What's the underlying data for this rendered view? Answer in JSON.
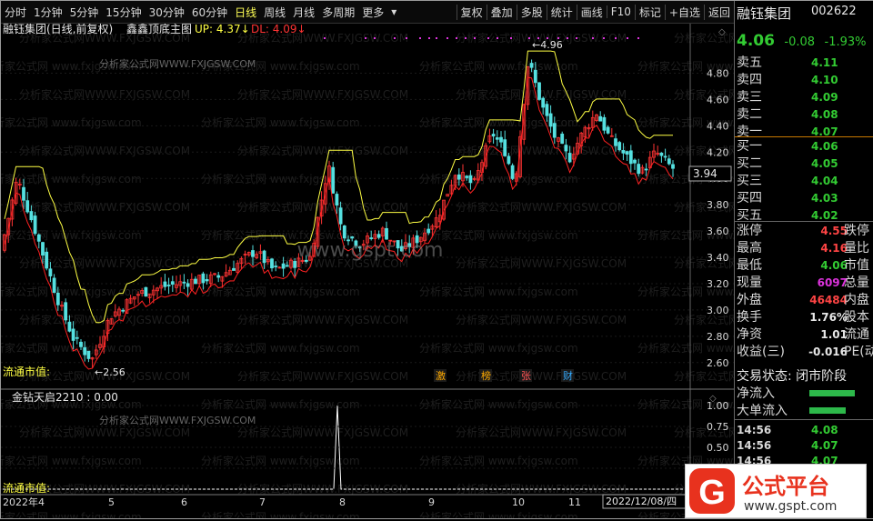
{
  "toolbar": {
    "left": [
      "分时",
      "1分钟",
      "5分钟",
      "15分钟",
      "30分钟",
      "60分钟",
      "日线",
      "周线",
      "月线",
      "多周期",
      "更多"
    ],
    "more_arrow": "▾",
    "right": [
      "复权",
      "叠加",
      "多股",
      "统计",
      "画线",
      "F10",
      "标记",
      "+自选",
      "返回"
    ],
    "active": "日线"
  },
  "chart": {
    "title": "融钰集团(日线,前复权)",
    "indicator": "鑫鑫顶底主图",
    "up": "UP: 4.37↓",
    "dl": "DL: 4.09↓",
    "high_mark": "4.96",
    "low_mark": "2.56",
    "current_price_box": "3.94",
    "liutong": "流通市值:",
    "badges": [
      "激",
      "榜",
      "张",
      "财"
    ],
    "sub_title": "金钻天启2210 : 0.00",
    "sub_liutong": "流通市值:",
    "xaxis": [
      "2022年4",
      "5",
      "6",
      "7",
      "8",
      "9",
      "10",
      "11"
    ],
    "date_box": "2022/12/08/四",
    "yticks": [
      "4.80",
      "4.60",
      "4.40",
      "4.20",
      "4.00",
      "3.80",
      "3.60",
      "3.40",
      "3.20",
      "3.00",
      "2.80",
      "2.60"
    ],
    "sub_yticks": [
      "1.00",
      "0.75",
      "0.50",
      "0.25",
      "0.00"
    ],
    "watermark_url": "www.gspt.com",
    "watermark_a": "分析家公式网WWW.FXJGSW.COM",
    "watermark_b": "分析家公式网 www.fxjgsw.com",
    "colors": {
      "up": "#ff3333",
      "down": "#55e0e0",
      "yellow": "#ffff44",
      "dl": "#ff2222",
      "magenta": "#dd33dd"
    }
  },
  "chart_data": {
    "type": "candlestick",
    "title": "融钰集团(日线,前复权)",
    "ylim": [
      2.5,
      5.0
    ],
    "high": 4.96,
    "low": 2.56,
    "up_line": [
      4.37
    ],
    "dl_line": [
      4.09
    ]
  },
  "quote": {
    "name": "融钰集团",
    "code": "002622",
    "price": "4.06",
    "change": "-0.08",
    "pct": "-1.93%",
    "sells": [
      {
        "l": "卖五",
        "v": "4.11"
      },
      {
        "l": "卖四",
        "v": "4.10"
      },
      {
        "l": "卖三",
        "v": "4.09"
      },
      {
        "l": "卖二",
        "v": "4.08"
      },
      {
        "l": "卖一",
        "v": "4.07"
      }
    ],
    "buys": [
      {
        "l": "买一",
        "v": "4.06"
      },
      {
        "l": "买二",
        "v": "4.05"
      },
      {
        "l": "买三",
        "v": "4.04"
      },
      {
        "l": "买四",
        "v": "4.03"
      },
      {
        "l": "买五",
        "v": "4.02"
      }
    ],
    "stats": [
      {
        "l": "涨停",
        "v": "4.55",
        "s": "跌停",
        "c": "r"
      },
      {
        "l": "最高",
        "v": "4.16",
        "s": "量比",
        "c": "r"
      },
      {
        "l": "最低",
        "v": "4.06",
        "s": "市值",
        "c": "g"
      },
      {
        "l": "现量",
        "v": "6097",
        "s": "总量",
        "c": "p"
      },
      {
        "l": "外盘",
        "v": "46484",
        "s": "内盘",
        "c": "r"
      },
      {
        "l": "换手",
        "v": "1.76%",
        "s": "股本",
        "c": "w"
      },
      {
        "l": "净资",
        "v": "1.01",
        "s": "流通",
        "c": "w"
      },
      {
        "l": "收益(三)",
        "v": "-0.016",
        "s": "PE(动)",
        "c": "w"
      }
    ],
    "status": "交易状态: 闭市阶段",
    "flow": [
      {
        "l": "净流入"
      },
      {
        "l": "大单流入"
      }
    ],
    "ticks": [
      {
        "t": "14:56",
        "v": "4.08"
      },
      {
        "t": "14:56",
        "v": "4.07"
      },
      {
        "t": "14:56",
        "v": "4.07"
      },
      {
        "t": "14:57",
        "v": "4.07"
      }
    ]
  },
  "logo": {
    "text": "公式平台",
    "url": "www.gspt.com"
  }
}
